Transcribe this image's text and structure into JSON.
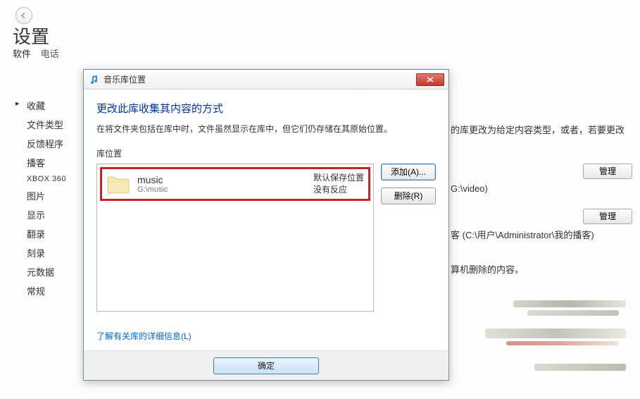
{
  "header": {
    "title": "设置"
  },
  "tabs": [
    {
      "label": "软件",
      "active": true
    },
    {
      "label": "电话",
      "active": false
    }
  ],
  "sidebar": {
    "items": [
      {
        "label": "收藏",
        "selected": true
      },
      {
        "label": "文件类型"
      },
      {
        "label": "反馈程序"
      },
      {
        "label": "播客"
      },
      {
        "label": "XBOX 360",
        "class": "xbox"
      },
      {
        "label": "图片"
      },
      {
        "label": "显示"
      },
      {
        "label": "翻录"
      },
      {
        "label": "刻录"
      },
      {
        "label": "元数据"
      },
      {
        "label": "常规"
      }
    ]
  },
  "background": {
    "line1": "的库更改为给定内容类型，或者，若要更改",
    "line2": "G:\\video)",
    "line3": "客 (C:\\用户\\Administrator\\我的播客)",
    "line4": "算机删除的内容。",
    "manage_label": "管理"
  },
  "dialog": {
    "title": "音乐库位置",
    "heading": "更改此库收集其内容的方式",
    "description": "在将文件夹包括在库中时，文件虽然显示在库中，但它们仍存储在其原始位置。",
    "list_label": "库位置",
    "entry": {
      "name": "music",
      "path": "G:\\music",
      "status1": "默认保存位置",
      "status2": "没有反应"
    },
    "buttons": {
      "add": "添加(A)...",
      "remove": "删除(R)"
    },
    "learn_link": "了解有关库的详细信息(L)",
    "ok": "确定"
  }
}
